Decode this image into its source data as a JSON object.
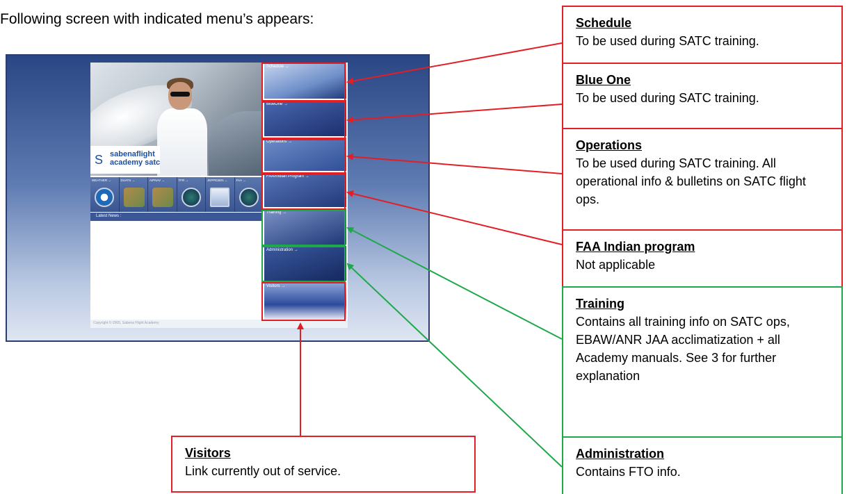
{
  "intro": "Following screen with indicated menu’s appears:",
  "portal": {
    "logo_top": "sabenaflight",
    "logo_bottom": "academy satc",
    "quick_links": [
      "WEATHER →",
      "DUATS →",
      "AIPNAV →",
      "TFR →",
      "JEPPESEN →",
      "FAA →"
    ],
    "latest_news": "Latest News :",
    "copyright": "Copyright © 2005, Sabena Flight Academy",
    "tiles": {
      "schedule": "Schedule →",
      "blue_one": "BlueOne →",
      "operations": "Operations →",
      "faa": "FAA/Indian Program →",
      "training": "Training →",
      "administration": "Administration →",
      "visitors": "Visitors →"
    }
  },
  "callouts": {
    "schedule": {
      "title": "Schedule",
      "body": "To be used during SATC training."
    },
    "blue_one": {
      "title": "Blue One",
      "body": "To be used during SATC training."
    },
    "operations": {
      "title": "Operations",
      "body": "To be used during SATC training. All operational info & bulletins on SATC flight ops."
    },
    "faa": {
      "title": "FAA Indian program",
      "body": "Not applicable"
    },
    "training": {
      "title": "Training",
      "body": "Contains all training info on SATC ops, EBAW/ANR JAA acclimatization + all Academy manuals. See 3 for further explanation"
    },
    "administration": {
      "title": "Administration",
      "body": "Contains FTO info."
    },
    "visitors": {
      "title": "Visitors",
      "body": "Link currently out of service."
    }
  },
  "colors": {
    "red": "#e31e24",
    "green": "#1fa84a",
    "navy": "#2b3d6e"
  }
}
